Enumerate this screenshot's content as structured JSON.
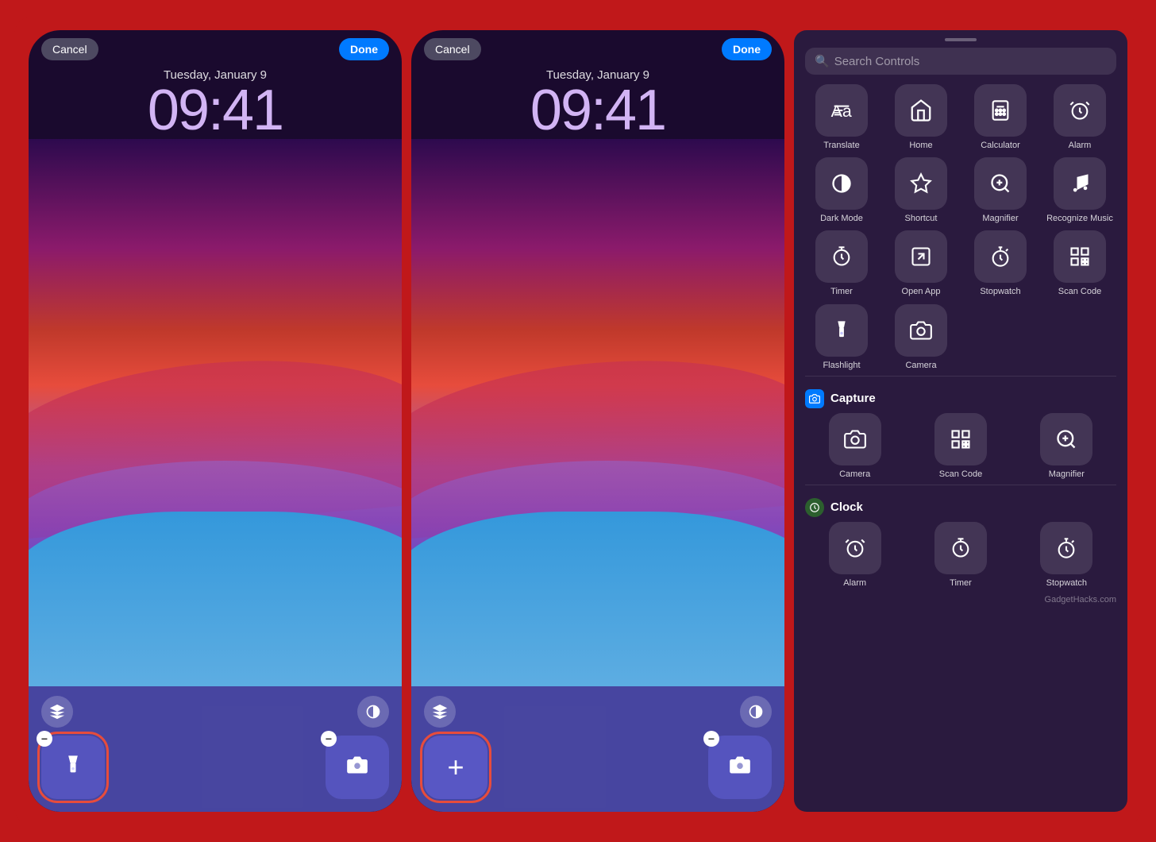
{
  "background_color": "#c0181a",
  "phone1": {
    "cancel_label": "Cancel",
    "done_label": "Done",
    "date": "Tuesday, January 9",
    "time": "09:41",
    "bottom_icons": {
      "layers_icon": "⊞",
      "circle_half_icon": "◑"
    },
    "controls": [
      {
        "icon": "🔦",
        "has_minus": true,
        "highlighted": true
      },
      {
        "icon": "📷",
        "has_minus": true,
        "highlighted": false
      }
    ]
  },
  "phone2": {
    "cancel_label": "Cancel",
    "done_label": "Done",
    "date": "Tuesday, January 9",
    "time": "09:41",
    "bottom_icons": {
      "layers_icon": "⊞",
      "circle_half_icon": "◑"
    },
    "controls": [
      {
        "icon": "+",
        "has_minus": false,
        "highlighted": true
      },
      {
        "icon": "📷",
        "has_minus": true,
        "highlighted": false
      }
    ]
  },
  "right_panel": {
    "search_placeholder": "Search Controls",
    "grid_items": [
      {
        "label": "Translate",
        "icon": "Aa",
        "icon_type": "translate"
      },
      {
        "label": "Home",
        "icon": "⌂",
        "icon_type": "home"
      },
      {
        "label": "Calculator",
        "icon": "⊞",
        "icon_type": "calculator"
      },
      {
        "label": "Alarm",
        "icon": "⏰",
        "icon_type": "alarm"
      },
      {
        "label": "Dark Mode",
        "icon": "◑",
        "icon_type": "dark-mode"
      },
      {
        "label": "Shortcut",
        "icon": "◈",
        "icon_type": "shortcut"
      },
      {
        "label": "Magnifier",
        "icon": "🔍",
        "icon_type": "magnifier"
      },
      {
        "label": "Recognize\nMusic",
        "icon": "♪",
        "icon_type": "music"
      },
      {
        "label": "Timer",
        "icon": "⏱",
        "icon_type": "timer"
      },
      {
        "label": "Open App",
        "icon": "⊡",
        "icon_type": "open-app"
      },
      {
        "label": "Stopwatch",
        "icon": "⏱",
        "icon_type": "stopwatch"
      },
      {
        "label": "Scan Code",
        "icon": "▦",
        "icon_type": "scan-code"
      },
      {
        "label": "Flashlight",
        "icon": "🔦",
        "icon_type": "flashlight"
      },
      {
        "label": "Camera",
        "icon": "📷",
        "icon_type": "camera"
      }
    ],
    "capture_section": {
      "title": "Capture",
      "items": [
        {
          "label": "Camera",
          "icon": "📷",
          "icon_type": "camera"
        },
        {
          "label": "Scan Code",
          "icon": "▦",
          "icon_type": "scan-code"
        },
        {
          "label": "Magnifier",
          "icon": "🔍",
          "icon_type": "magnifier"
        }
      ]
    },
    "clock_section": {
      "title": "Clock",
      "items": [
        {
          "label": "Alarm",
          "icon": "⏰",
          "icon_type": "alarm"
        },
        {
          "label": "Timer",
          "icon": "⏱",
          "icon_type": "timer"
        },
        {
          "label": "Stopwatch",
          "icon": "⏱",
          "icon_type": "stopwatch"
        }
      ]
    }
  },
  "watermark": "GadgetHacks.com"
}
